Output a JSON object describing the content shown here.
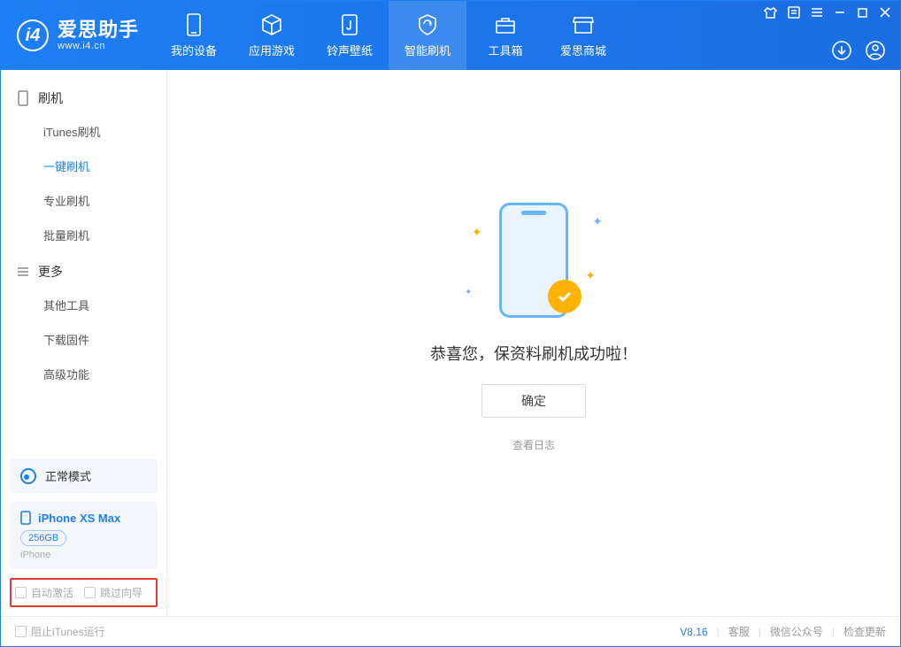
{
  "brand": {
    "title": "爱思助手",
    "subtitle": "www.i4.cn",
    "logo_letter": "i4"
  },
  "nav": [
    {
      "label": "我的设备"
    },
    {
      "label": "应用游戏"
    },
    {
      "label": "铃声壁纸"
    },
    {
      "label": "智能刷机"
    },
    {
      "label": "工具箱"
    },
    {
      "label": "爱思商城"
    }
  ],
  "sidebar": {
    "group1": {
      "title": "刷机",
      "items": [
        "iTunes刷机",
        "一键刷机",
        "专业刷机",
        "批量刷机"
      ]
    },
    "group2": {
      "title": "更多",
      "items": [
        "其他工具",
        "下载固件",
        "高级功能"
      ]
    },
    "mode": "正常模式",
    "device": {
      "name": "iPhone XS Max",
      "capacity": "256GB",
      "type": "iPhone"
    },
    "checks": {
      "auto_activate": "自动激活",
      "skip_guide": "跳过向导"
    }
  },
  "main": {
    "message": "恭喜您，保资料刷机成功啦！",
    "ok": "确定",
    "log": "查看日志"
  },
  "footer": {
    "block_itunes": "阻止iTunes运行",
    "version": "V8.16",
    "support": "客服",
    "wechat": "微信公众号",
    "update": "检查更新"
  }
}
